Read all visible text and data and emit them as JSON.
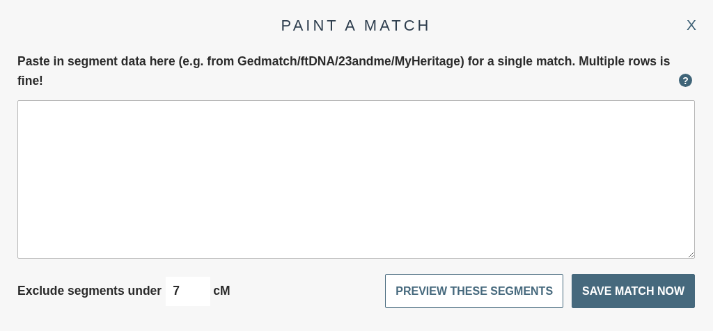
{
  "dialog": {
    "title": "PAINT A MATCH",
    "close": "X"
  },
  "instructions": "Paste in segment data here (e.g. from Gedmatch/ftDNA/23andme/MyHeritage) for a single match. Multiple rows is fine!",
  "help": "?",
  "exclude": {
    "label": "Exclude segments under",
    "value": "7",
    "unit": "cM"
  },
  "buttons": [
    {
      "label": "PREVIEW THESE SEGMENTS",
      "kind": "outline"
    },
    {
      "label": "SAVE MATCH NOW",
      "kind": "primary"
    }
  ]
}
